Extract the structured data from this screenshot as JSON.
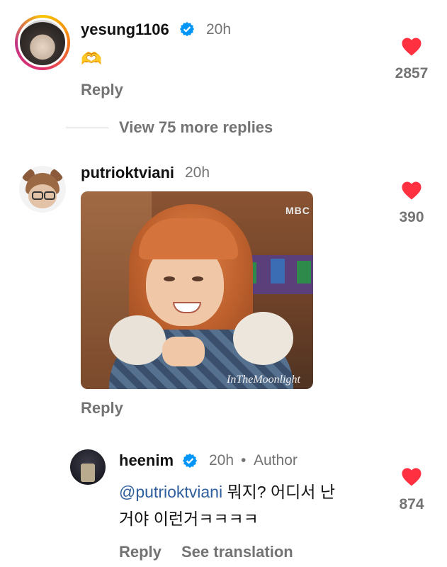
{
  "comments": [
    {
      "username": "yesung1106",
      "time": "20h",
      "emoji": "🫶",
      "reply_label": "Reply",
      "likes": "2857"
    },
    {
      "username": "putrioktviani",
      "time": "20h",
      "gif_watermark_top": "MBC",
      "gif_watermark_bottom": "InTheMoonlight",
      "reply_label": "Reply",
      "likes": "390"
    }
  ],
  "view_more_replies": "View 75 more replies",
  "reply": {
    "username": "heenim",
    "time": "20h",
    "separator": "•",
    "author_badge": "Author",
    "mention": "@putrioktviani",
    "text_line1": " 뭐지? 어디서 난",
    "text_line2": "거야 이런거ㅋㅋㅋㅋ",
    "reply_label": "Reply",
    "see_translation": "See translation",
    "likes": "874"
  },
  "colors": {
    "like_red": "#ff3040",
    "verified_blue": "#0095f6",
    "muted_text": "#737373",
    "mention_blue": "#2f5f9e"
  }
}
